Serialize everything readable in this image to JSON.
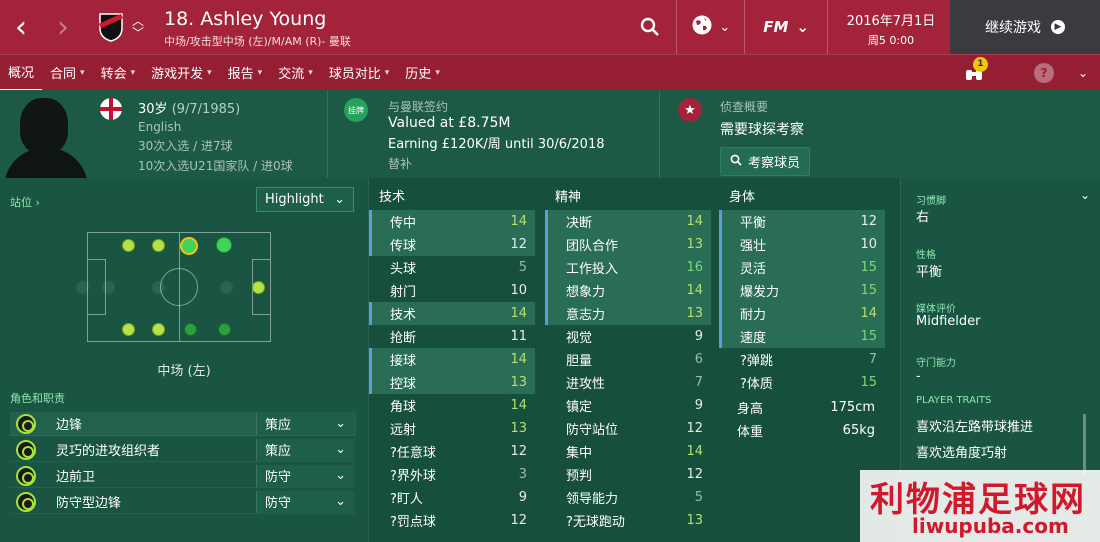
{
  "topbar": {
    "title": "18. Ashley Young",
    "subtitle": "中场/攻击型中场 (左)/M/AM (R)- 曼联",
    "date": "2016年7月1日",
    "time": "周5 0:00",
    "continue_label": "继续游戏",
    "fm_label": "FM",
    "accent": "#a3233a"
  },
  "tabs": [
    {
      "label": "概况",
      "has_menu": false
    },
    {
      "label": "合同",
      "has_menu": true
    },
    {
      "label": "转会",
      "has_menu": true
    },
    {
      "label": "游戏开发",
      "has_menu": true
    },
    {
      "label": "报告",
      "has_menu": true
    },
    {
      "label": "交流",
      "has_menu": true
    },
    {
      "label": "球员对比",
      "has_menu": true
    },
    {
      "label": "历史",
      "has_menu": true
    }
  ],
  "notification_count": "1",
  "info": {
    "age": "30岁",
    "dob": "(9/7/1985)",
    "nationality": "English",
    "caps": "30次入选 / 进7球",
    "u21_caps": "10次入选U21国家队 / 进0球",
    "contract_label": "与曼联签约",
    "loan_label": "挂牌",
    "value": "Valued at £8.75M",
    "wage": "Earning £120K/周 until 30/6/2018",
    "squad_status": "替补",
    "scout_label": "侦查概要",
    "scout_status": "需要球探考察",
    "scout_button": "考察球员"
  },
  "left": {
    "position_link": "站位",
    "highlight_label": "Highlight",
    "position_name": "中场 (左)",
    "roles_label": "角色和职责",
    "roles": [
      {
        "name": "边锋",
        "duty": "策应"
      },
      {
        "name": "灵巧的进攻组织者",
        "duty": "策应"
      },
      {
        "name": "边前卫",
        "duty": "防守"
      },
      {
        "name": "防守型边锋",
        "duty": "防守"
      }
    ]
  },
  "attributes": {
    "technical_title": "技术",
    "mental_title": "精神",
    "physical_title": "身体",
    "technical": [
      {
        "name": "传中",
        "value": "14"
      },
      {
        "name": "传球",
        "value": "12"
      },
      {
        "name": "头球",
        "value": "5"
      },
      {
        "name": "射门",
        "value": "10"
      },
      {
        "name": "技术",
        "value": "14"
      },
      {
        "name": "抢断",
        "value": "11"
      },
      {
        "name": "接球",
        "value": "14"
      },
      {
        "name": "控球",
        "value": "13"
      },
      {
        "name": "角球",
        "value": "14"
      },
      {
        "name": "远射",
        "value": "13"
      },
      {
        "name": "?任意球",
        "value": "12"
      },
      {
        "name": "?界外球",
        "value": "3"
      },
      {
        "name": "?盯人",
        "value": "9"
      },
      {
        "name": "?罚点球",
        "value": "12"
      }
    ],
    "mental": [
      {
        "name": "决断",
        "value": "14"
      },
      {
        "name": "团队合作",
        "value": "13"
      },
      {
        "name": "工作投入",
        "value": "16"
      },
      {
        "name": "想象力",
        "value": "14"
      },
      {
        "name": "意志力",
        "value": "13"
      },
      {
        "name": "视觉",
        "value": "9"
      },
      {
        "name": "胆量",
        "value": "6"
      },
      {
        "name": "进攻性",
        "value": "7"
      },
      {
        "name": "镇定",
        "value": "9"
      },
      {
        "name": "防守站位",
        "value": "12"
      },
      {
        "name": "集中",
        "value": "14"
      },
      {
        "name": "预判",
        "value": "12"
      },
      {
        "name": "领导能力",
        "value": "5"
      },
      {
        "name": "?无球跑动",
        "value": "13"
      }
    ],
    "physical": [
      {
        "name": "平衡",
        "value": "12"
      },
      {
        "name": "强壮",
        "value": "10"
      },
      {
        "name": "灵活",
        "value": "15"
      },
      {
        "name": "爆发力",
        "value": "15"
      },
      {
        "name": "耐力",
        "value": "14"
      },
      {
        "name": "速度",
        "value": "15"
      },
      {
        "name": "?弹跳",
        "value": "7"
      },
      {
        "name": "?体质",
        "value": "15"
      }
    ],
    "height_label": "身高",
    "height": "175cm",
    "weight_label": "体重",
    "weight": "65kg"
  },
  "right": {
    "foot_label": "习惯脚",
    "foot": "右",
    "personality_label": "性格",
    "personality": "平衡",
    "media_label": "媒体评价",
    "media": "Midfielder",
    "gk_label": "守门能力",
    "gk": "-",
    "traits_label": "PLAYER TRAITS",
    "traits": [
      "喜欢沿左路带球推进",
      "喜欢选角度巧射"
    ]
  },
  "watermark": {
    "main": "利物浦足球网",
    "url": "liwupuba.com"
  }
}
